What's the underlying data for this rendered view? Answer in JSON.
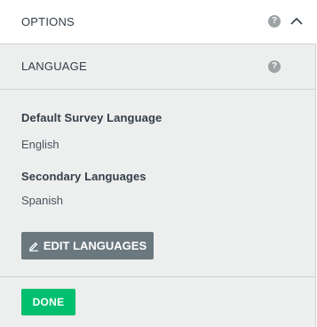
{
  "options": {
    "title": "OPTIONS",
    "help_icon": "?",
    "collapse_icon": "chevron-up-icon"
  },
  "language": {
    "title": "LANGUAGE",
    "help_icon": "?",
    "default_label": "Default Survey Language",
    "default_value": "English",
    "secondary_label": "Secondary Languages",
    "secondary_value": "Spanish",
    "edit_button": "EDIT LANGUAGES",
    "edit_icon": "pencil-icon"
  },
  "actions": {
    "done_label": "DONE"
  },
  "colors": {
    "done_green": "#00bf6f",
    "edit_gray": "#6b787f",
    "panel_bg": "#edeeee",
    "help_icon_gray": "#9da2a5"
  }
}
